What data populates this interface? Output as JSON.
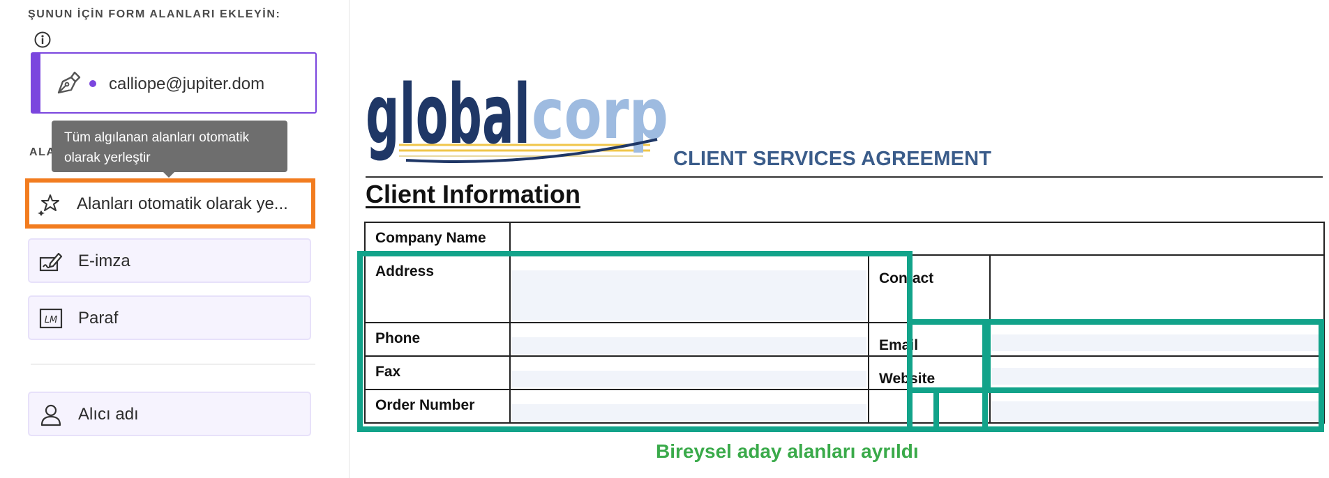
{
  "panel": {
    "title": "ŞUNUN İÇİN FORM ALANLARI EKLEYİN:",
    "recipient_email": "calliope@jupiter.dom",
    "section_label": "ALA",
    "tooltip": "Tüm algılanan alanları otomatik olarak yerleştir",
    "buttons": {
      "auto_place": "Alanları otomatik olarak ye...",
      "esign": "E-imza",
      "initials": "Paraf",
      "recipient_name": "Alıcı adı"
    },
    "initials_glyph": "LM"
  },
  "document": {
    "logo": {
      "part1": "global",
      "part2": "corp"
    },
    "agreement_title": "CLIENT SERVICES AGREEMENT",
    "section_title": "Client Information",
    "fields": {
      "company_name": "Company Name",
      "address": "Address",
      "contact": "Contact",
      "phone": "Phone",
      "email": "Email",
      "fax": "Fax",
      "website": "Website",
      "order_number": "Order Number"
    }
  },
  "annotation": {
    "caption": "Bireysel aday alanları ayrıldı",
    "colors": {
      "orange": "#f27c1f",
      "teal": "#12a38a",
      "caption": "#3aaa4a",
      "accent": "#7b46de"
    }
  }
}
